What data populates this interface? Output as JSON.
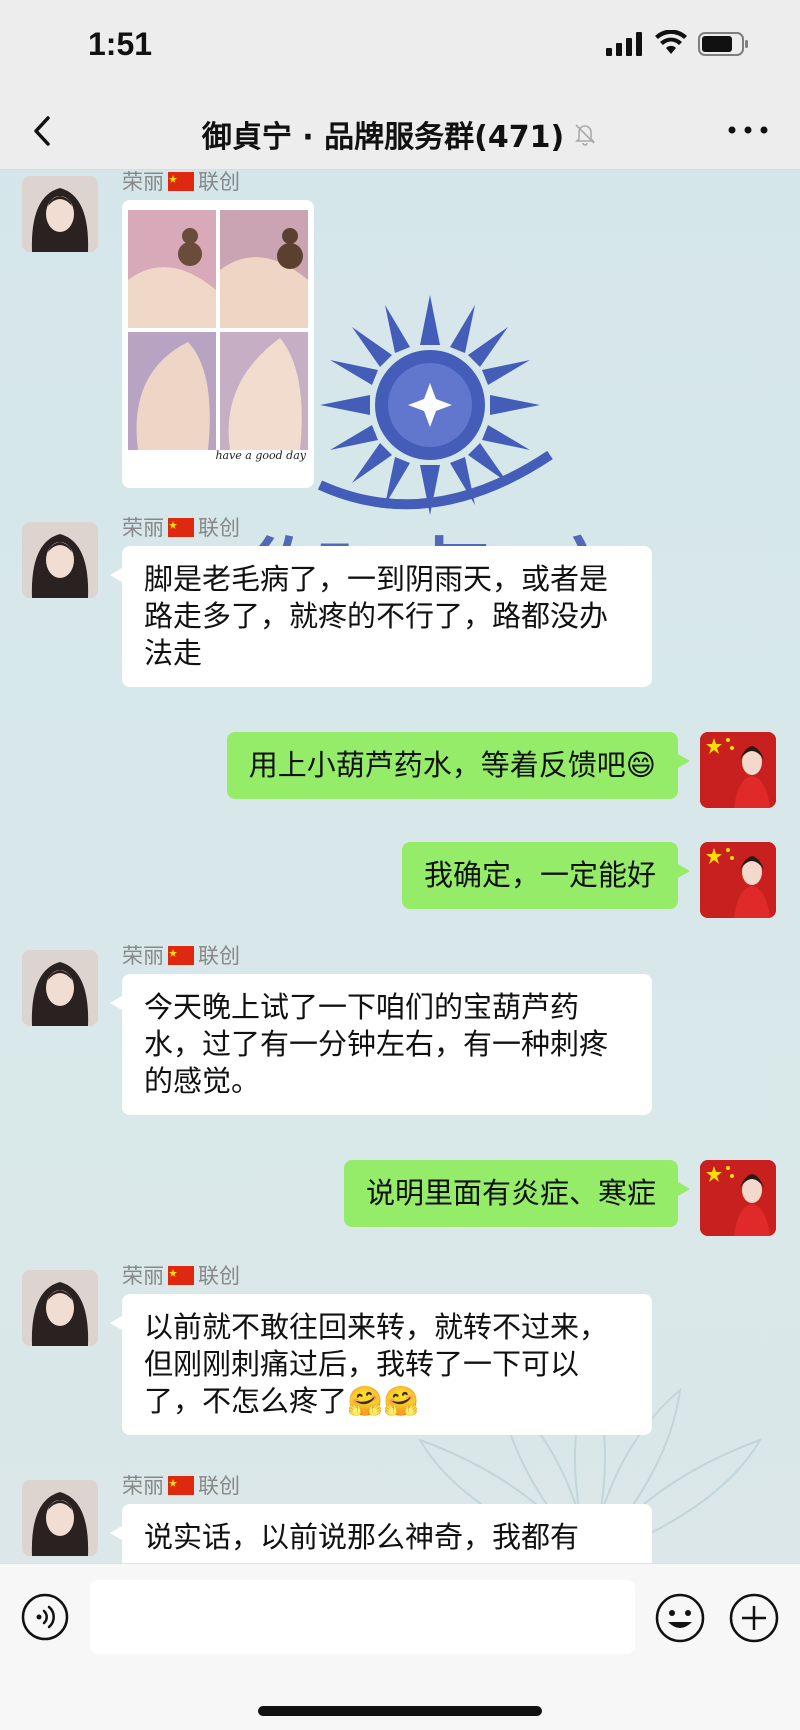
{
  "status": {
    "time": "1:51",
    "icons": [
      "signal-icon",
      "wifi-icon",
      "battery-icon"
    ]
  },
  "nav": {
    "title": "御貞宁 · 品牌服务群(471)",
    "icons": [
      "back-icon",
      "mute-bell-icon",
      "more-icon"
    ]
  },
  "watermark": {
    "text": "御貞宁"
  },
  "photo_caption": "have a good day",
  "messages": [
    {
      "side": "left",
      "sender": "荣丽",
      "sender_suffix": "联创",
      "type": "image"
    },
    {
      "side": "left",
      "sender": "荣丽",
      "sender_suffix": "联创",
      "type": "text",
      "text": "脚是老毛病了，一到阴雨天，或者是路走多了，就疼的不行了，路都没办法走"
    },
    {
      "side": "right",
      "type": "text",
      "text": "用上小葫芦药水，等着反馈吧😄"
    },
    {
      "side": "right",
      "type": "text",
      "text": "我确定，一定能好"
    },
    {
      "side": "left",
      "sender": "荣丽",
      "sender_suffix": "联创",
      "type": "text",
      "text": "今天晚上试了一下咱们的宝葫芦药水，过了有一分钟左右，有一种刺疼的感觉。"
    },
    {
      "side": "right",
      "type": "text",
      "text": "说明里面有炎症、寒症"
    },
    {
      "side": "left",
      "sender": "荣丽",
      "sender_suffix": "联创",
      "type": "text",
      "text": "以前就不敢往回来转，就转不过来，但刚刚刺痛过后，我转了一下可以了，不怎么疼了🤗🤗"
    },
    {
      "side": "left",
      "sender": "荣丽",
      "sender_suffix": "联创",
      "type": "text",
      "text": "说实话，以前说那么神奇，我都有"
    }
  ],
  "input": {
    "value": "",
    "placeholder": "",
    "icons": [
      "voice-icon",
      "emoji-icon",
      "add-icon"
    ]
  },
  "colors": {
    "outgoing_bubble": "#95ec69",
    "incoming_bubble": "#ffffff",
    "bar_bg": "#ededed",
    "chat_bg": "#d5e6ea"
  }
}
